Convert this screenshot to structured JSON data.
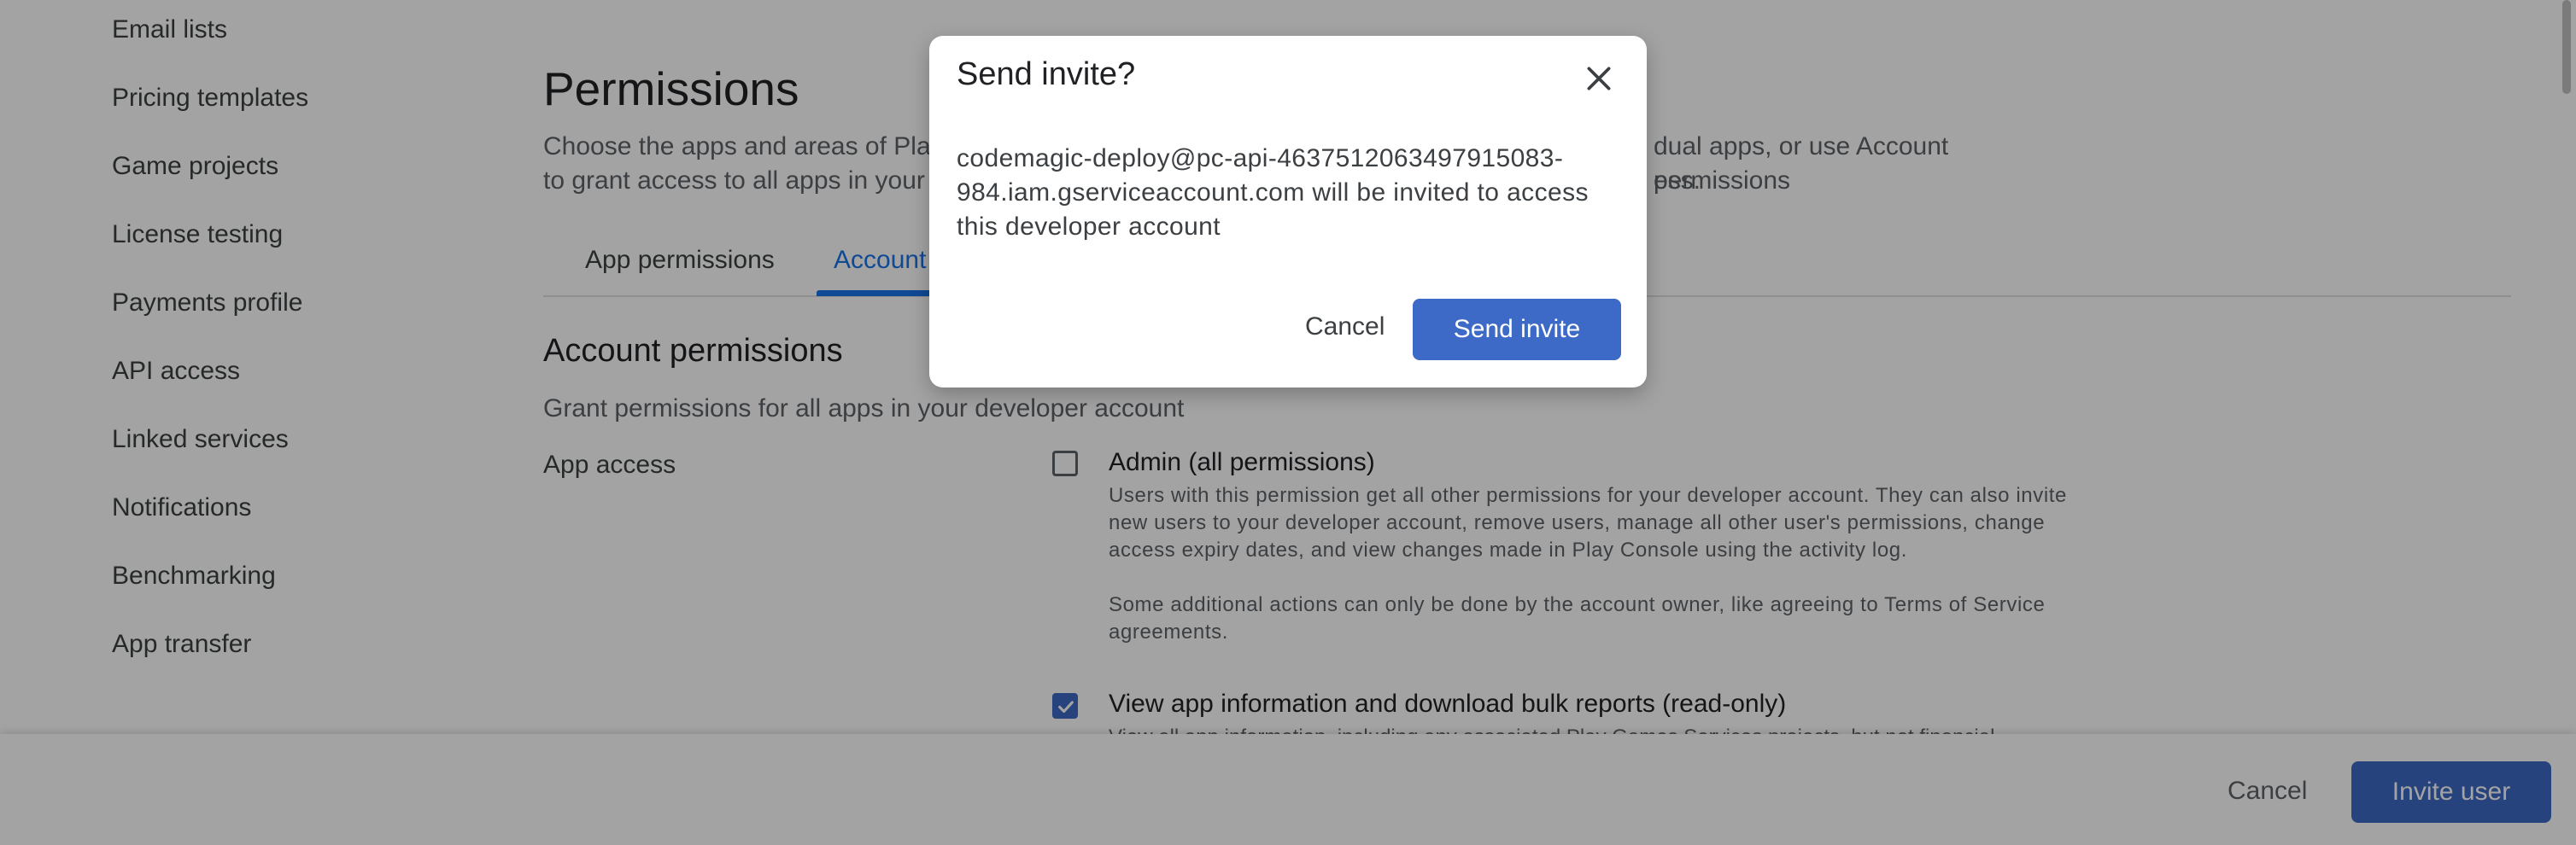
{
  "sidebar": {
    "items": [
      {
        "label": "Email lists"
      },
      {
        "label": "Pricing templates"
      },
      {
        "label": "Game projects"
      },
      {
        "label": "License testing"
      },
      {
        "label": "Payments profile"
      },
      {
        "label": "API access"
      },
      {
        "label": "Linked services"
      },
      {
        "label": "Notifications"
      },
      {
        "label": "Benchmarking"
      },
      {
        "label": "App transfer"
      }
    ]
  },
  "main": {
    "title": "Permissions",
    "description_line1_left": "Choose the apps and areas of Play",
    "description_line1_right": "dual apps, or use Account permissions",
    "description_line2_left": "to grant access to all apps in your d",
    "description_line2_right": "ess.",
    "tabs": [
      {
        "label": "App permissions"
      },
      {
        "label": "Account"
      }
    ],
    "section_title": "Account permissions",
    "section_desc": "Grant permissions for all apps in your developer account",
    "app_access_label": "App access",
    "permissions": [
      {
        "title": "Admin (all permissions)",
        "desc1": "Users with this permission get all other permissions for your developer account. They can also invite new users to your developer account, remove users, manage all other user's permissions, change access expiry dates, and view changes made in Play Console using the activity log.",
        "desc2": "Some additional actions can only be done by the account owner, like agreeing to Terms of Service agreements.",
        "checked": false
      },
      {
        "title": "View app information and download bulk reports (read-only)",
        "desc_partial": "View all app information, including any associated Play Games Services projects, but not financial",
        "checked": true
      }
    ]
  },
  "bottom_bar": {
    "cancel_label": "Cancel",
    "invite_label": "Invite user"
  },
  "dialog": {
    "title": "Send invite?",
    "body": "codemagic-deploy@pc-api-4637512063497915083-984.iam.gserviceaccount.com will be invited to access this developer account",
    "cancel_label": "Cancel",
    "send_label": "Send invite"
  },
  "icons": {
    "close": "close-icon",
    "check": "check-icon"
  },
  "colors": {
    "primary_button": "#3c6ac6",
    "active_tab": "#1a73e8",
    "scrim": "rgba(0,0,0,0.36)"
  }
}
